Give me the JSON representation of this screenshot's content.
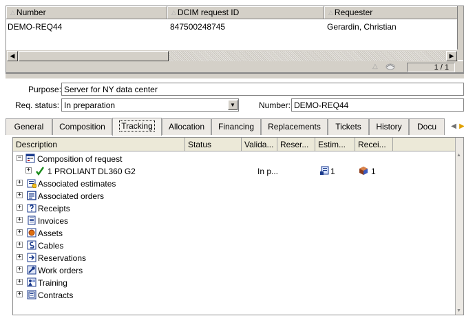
{
  "grid": {
    "columns": [
      "Number",
      "DCIM request ID",
      "Requester"
    ],
    "row": [
      "DEMO-REQ44",
      "847500248745",
      "Gerardin, Christian"
    ],
    "pager": "1 / 1"
  },
  "form": {
    "purpose_label": "Purpose:",
    "purpose_value": "Server for NY data center",
    "status_label": "Req. status:",
    "status_value": "In preparation",
    "number_label": "Number:",
    "number_value": "DEMO-REQ44"
  },
  "tabs": [
    "General",
    "Composition",
    "Tracking",
    "Allocation",
    "Financing",
    "Replacements",
    "Tickets",
    "History",
    "Docu"
  ],
  "active_tab": "Tracking",
  "tree": {
    "columns": [
      "Description",
      "Status",
      "Valida...",
      "Reser...",
      "Estim...",
      "Recei..."
    ],
    "rows": [
      {
        "label": "Composition of request",
        "toggle": "−",
        "icon": "composition-icon"
      },
      {
        "label": "1 PROLIANT DL360 G2",
        "toggle": "+",
        "icon": "checkmark-icon",
        "valida": "In p...",
        "estim": "1",
        "recei": "1"
      },
      {
        "label": "Associated estimates",
        "toggle": "+",
        "icon": "estimate-icon"
      },
      {
        "label": "Associated orders",
        "toggle": "+",
        "icon": "order-icon"
      },
      {
        "label": "Receipts",
        "toggle": "+",
        "icon": "receipt-icon"
      },
      {
        "label": "Invoices",
        "toggle": "+",
        "icon": "invoice-icon"
      },
      {
        "label": "Assets",
        "toggle": "+",
        "icon": "asset-icon"
      },
      {
        "label": "Cables",
        "toggle": "+",
        "icon": "cable-icon"
      },
      {
        "label": "Reservations",
        "toggle": "+",
        "icon": "reservation-icon"
      },
      {
        "label": "Work orders",
        "toggle": "+",
        "icon": "work-order-icon"
      },
      {
        "label": "Training",
        "toggle": "+",
        "icon": "training-icon"
      },
      {
        "label": "Contracts",
        "toggle": "+",
        "icon": "contract-icon"
      }
    ]
  },
  "colors": {
    "window": "#d4d0c8",
    "accent_green": "#1a8c1a",
    "header_light": "#ece9d8"
  }
}
